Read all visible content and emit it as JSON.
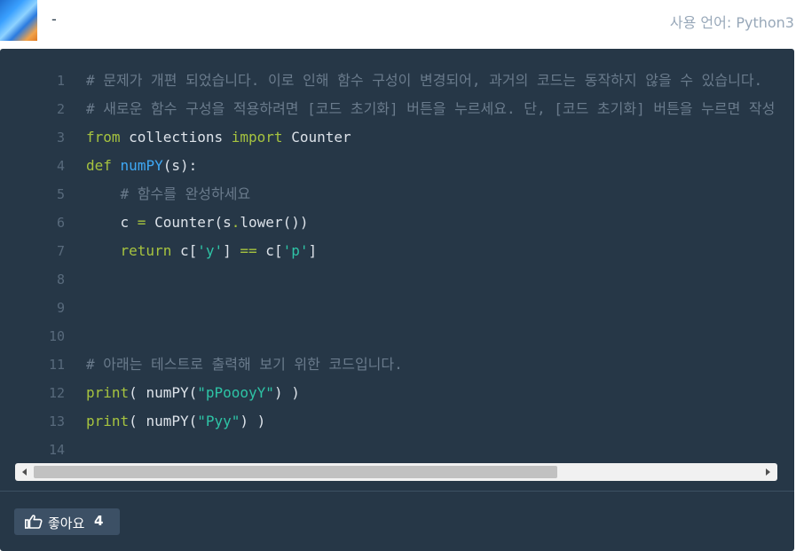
{
  "header": {
    "user_name": "-",
    "language_label": "사용 언어: Python3"
  },
  "editor": {
    "lines": [
      {
        "no": "1",
        "tokens": [
          {
            "t": "# 문제가 개편 되었습니다. 이로 인해 함수 구성이 변경되어, 과거의 코드는 동작하지 않을 수 있습니다.",
            "c": "comment"
          }
        ]
      },
      {
        "no": "2",
        "tokens": [
          {
            "t": "# 새로운 함수 구성을 적용하려면 [코드 초기화] 버튼을 누르세요. 단, [코드 초기화] 버튼을 누르면 작성 중인 코드는 사라집니다.",
            "c": "comment"
          }
        ]
      },
      {
        "no": "3",
        "tokens": [
          {
            "t": "from",
            "c": "keyword"
          },
          {
            "t": " collections ",
            "c": "plain"
          },
          {
            "t": "import",
            "c": "keyword"
          },
          {
            "t": " Counter",
            "c": "plain"
          }
        ]
      },
      {
        "no": "4",
        "tokens": [
          {
            "t": "def",
            "c": "keyword"
          },
          {
            "t": " ",
            "c": "plain"
          },
          {
            "t": "numPY",
            "c": "function"
          },
          {
            "t": "(s):",
            "c": "plain"
          }
        ]
      },
      {
        "no": "5",
        "tokens": [
          {
            "t": "    ",
            "c": "plain"
          },
          {
            "t": "# 함수를 완성하세요",
            "c": "comment"
          }
        ]
      },
      {
        "no": "6",
        "tokens": [
          {
            "t": "    c ",
            "c": "plain"
          },
          {
            "t": "=",
            "c": "op"
          },
          {
            "t": " Counter(s",
            "c": "plain"
          },
          {
            "t": ".",
            "c": "op"
          },
          {
            "t": "lower())",
            "c": "plain"
          }
        ]
      },
      {
        "no": "7",
        "tokens": [
          {
            "t": "    ",
            "c": "plain"
          },
          {
            "t": "return",
            "c": "keyword"
          },
          {
            "t": " c[",
            "c": "plain"
          },
          {
            "t": "'y'",
            "c": "string"
          },
          {
            "t": "] ",
            "c": "plain"
          },
          {
            "t": "==",
            "c": "op"
          },
          {
            "t": " c[",
            "c": "plain"
          },
          {
            "t": "'p'",
            "c": "string"
          },
          {
            "t": "]",
            "c": "plain"
          }
        ]
      },
      {
        "no": "8",
        "tokens": []
      },
      {
        "no": "9",
        "tokens": []
      },
      {
        "no": "10",
        "tokens": []
      },
      {
        "no": "11",
        "tokens": [
          {
            "t": "# 아래는 테스트로 출력해 보기 위한 코드입니다.",
            "c": "comment"
          }
        ]
      },
      {
        "no": "12",
        "tokens": [
          {
            "t": "print",
            "c": "keyword"
          },
          {
            "t": "( numPY(",
            "c": "plain"
          },
          {
            "t": "\"pPoooyY\"",
            "c": "string"
          },
          {
            "t": ") )",
            "c": "plain"
          }
        ]
      },
      {
        "no": "13",
        "tokens": [
          {
            "t": "print",
            "c": "keyword"
          },
          {
            "t": "( numPY(",
            "c": "plain"
          },
          {
            "t": "\"Pyy\"",
            "c": "string"
          },
          {
            "t": ") )",
            "c": "plain"
          }
        ]
      },
      {
        "no": "14",
        "tokens": []
      }
    ]
  },
  "footer": {
    "like_label": "좋아요",
    "like_count": "4"
  },
  "colors": {
    "panel_bg": "#263747",
    "comment": "#6a7b8c",
    "keyword": "#a6c33f",
    "function": "#3ea8f5",
    "string": "#2ec4a6"
  },
  "icons": {
    "like": "thumbs-up-icon"
  }
}
